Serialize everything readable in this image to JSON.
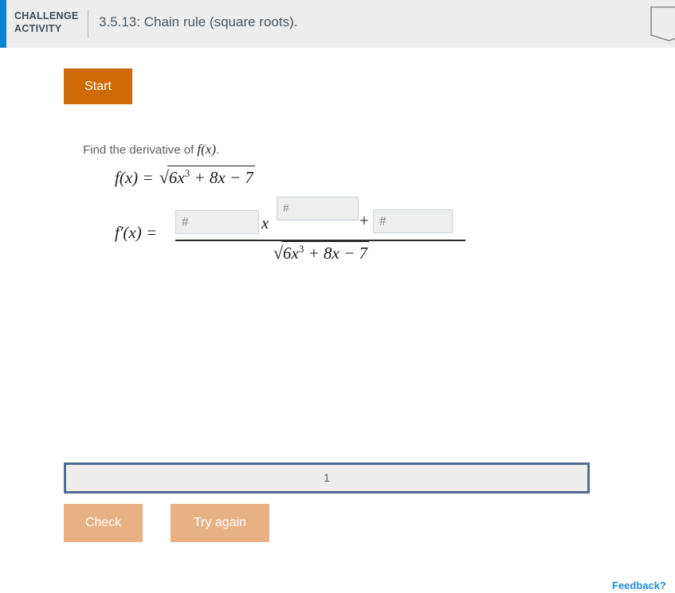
{
  "header": {
    "accent_color": "#0c84cd",
    "label_line1": "CHALLENGE",
    "label_line2": "ACTIVITY",
    "title": "3.5.13: Chain rule (square roots).",
    "bookmark_icon": "bookmark-ribbon-icon"
  },
  "start": {
    "label": "Start",
    "color": "#cd6a04"
  },
  "question": {
    "prompt_text": "Find the derivative of ",
    "prompt_function": "f(x)",
    "prompt_period": ".",
    "function_lhs": "f(x) =",
    "function_radicand": "6x3 + 8x − 7",
    "function_radicand_base": "6x",
    "function_radicand_exp": "3",
    "function_radicand_rest": " + 8x − 7",
    "derivative_lhs": "f′(x) =",
    "numerator_variable": "x",
    "numerator_plus": "+",
    "denominator_base": "6x",
    "denominator_exp": "3",
    "denominator_rest": " + 8x − 7",
    "inputs": [
      {
        "name": "coefficient",
        "value": "",
        "placeholder": "#"
      },
      {
        "name": "exponent",
        "value": "",
        "placeholder": "#"
      },
      {
        "name": "constant",
        "value": "",
        "placeholder": "#"
      }
    ]
  },
  "progress": {
    "value": "1",
    "border_color": "#546a91"
  },
  "actions": {
    "check_label": "Check",
    "try_again_label": "Try again",
    "disabled_color": "#e8b184"
  },
  "feedback": {
    "label": "Feedback?",
    "color": "#1c8ed6"
  }
}
